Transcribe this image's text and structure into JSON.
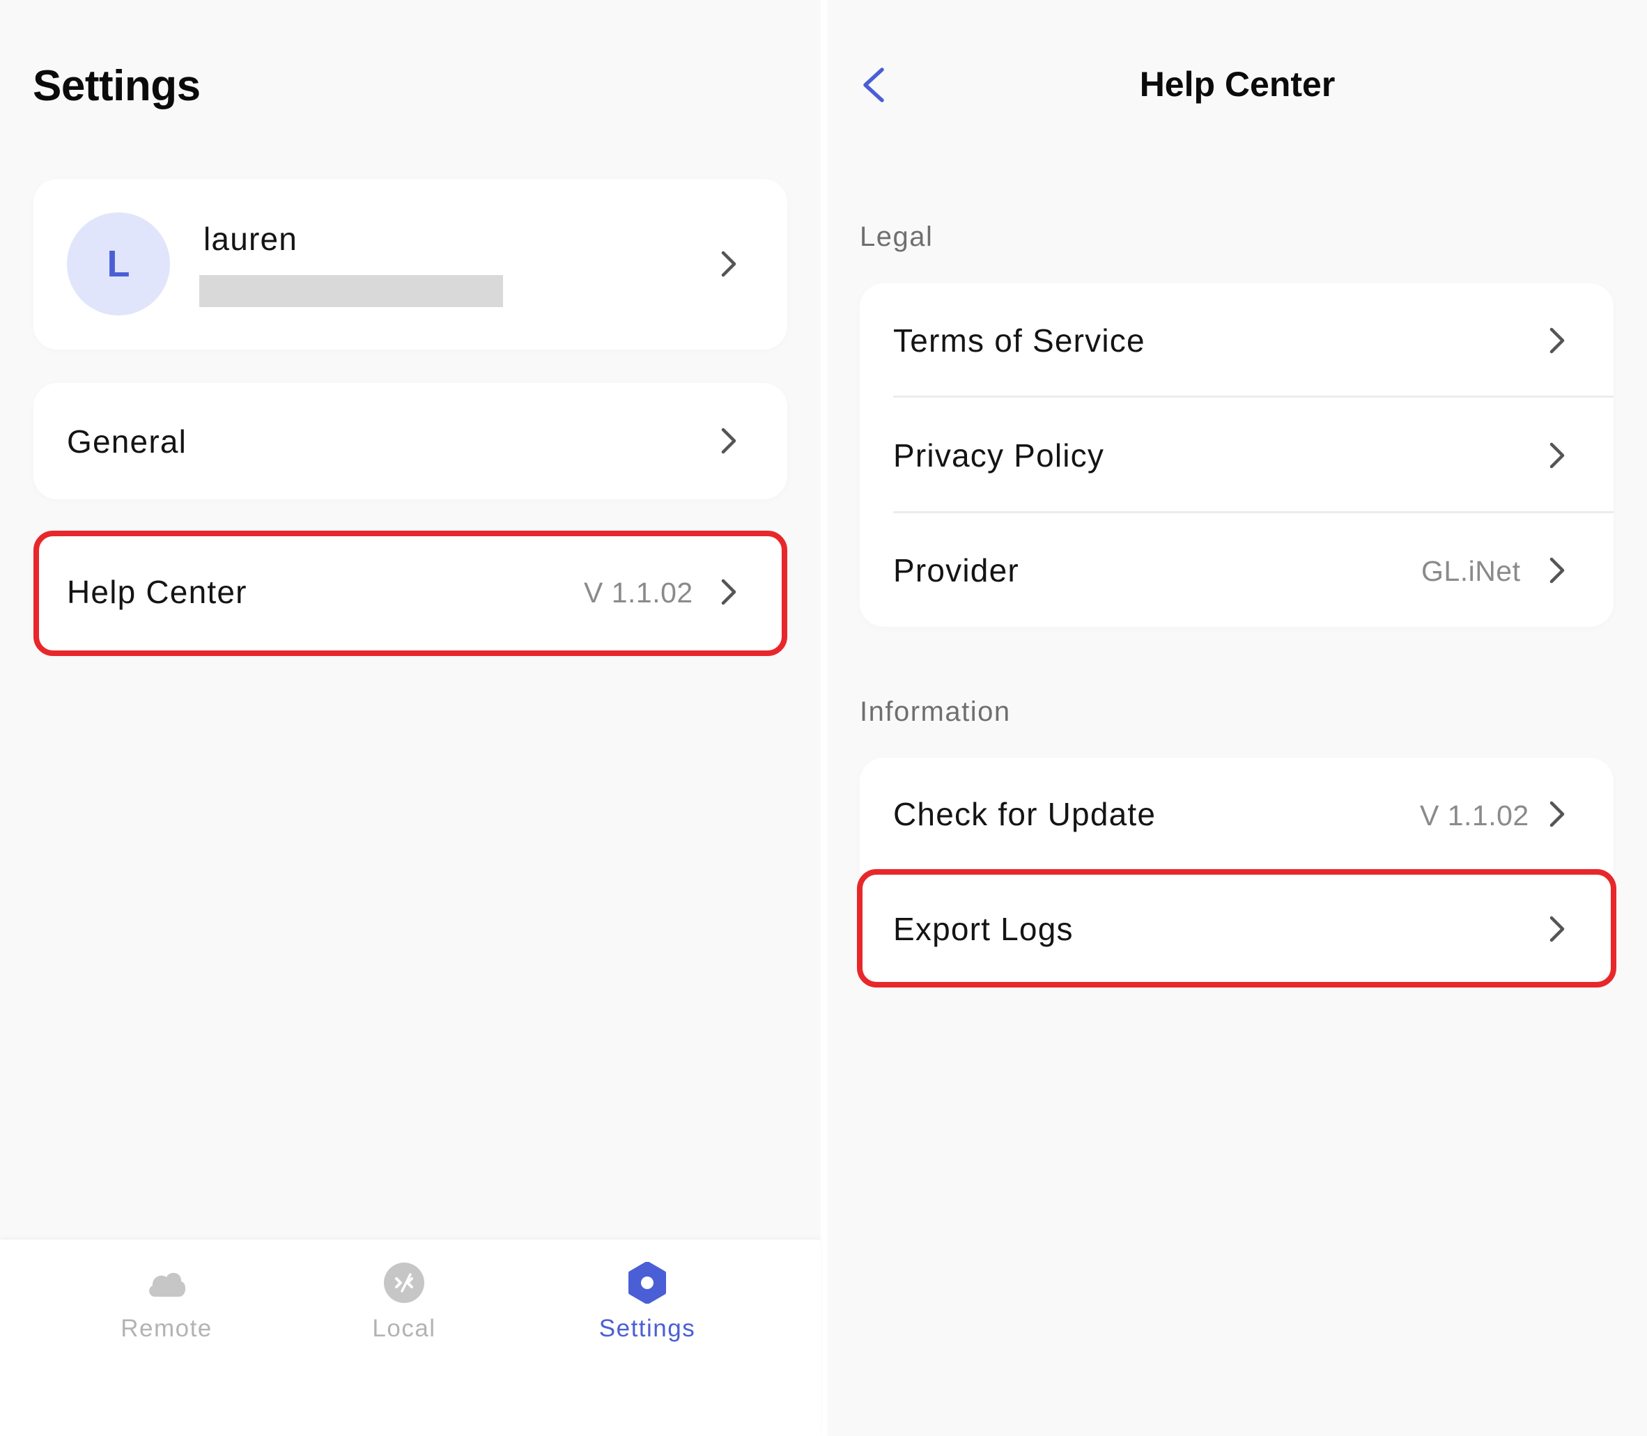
{
  "settings_screen": {
    "title": "Settings",
    "profile": {
      "avatar_initial": "L",
      "username": "lauren"
    },
    "general_label": "General",
    "help_center": {
      "label": "Help Center",
      "version": "V 1.1.02"
    },
    "tabs": [
      {
        "label": "Remote",
        "icon": "cloud-icon",
        "active": false
      },
      {
        "label": "Local",
        "icon": "local-connect-icon",
        "active": false
      },
      {
        "label": "Settings",
        "icon": "gear-icon",
        "active": true
      }
    ]
  },
  "help_center_screen": {
    "title": "Help Center",
    "legal_section": {
      "header": "Legal",
      "items": [
        {
          "label": "Terms of Service",
          "value": ""
        },
        {
          "label": "Privacy Policy",
          "value": ""
        },
        {
          "label": "Provider",
          "value": "GL.iNet"
        }
      ]
    },
    "information_section": {
      "header": "Information",
      "items": [
        {
          "label": "Check for Update",
          "value": "V 1.1.02"
        },
        {
          "label": "Export Logs",
          "value": ""
        }
      ]
    }
  },
  "colors": {
    "accent": "#4a5fd6",
    "highlight": "#e8272b",
    "background": "#f9f9f9",
    "card": "#ffffff",
    "inactive_tab": "#b3b3b3"
  }
}
